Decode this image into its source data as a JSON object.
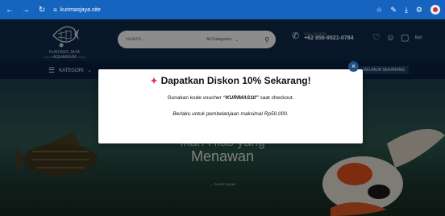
{
  "browser": {
    "url": "kurimasjaya.site",
    "colors": {
      "toolbar": "#1565c0"
    }
  },
  "header": {
    "brand": "KURIMAS JAYA AQUARIUM",
    "tagline": "IKAN HIAS & AKSESORIS AQUARIUM",
    "search_placeholder": "Search...",
    "category_select": "All Categories",
    "call_label": "CALL US NOW:",
    "phone": "+62 858-9521-0784",
    "cart_total": "Rp0"
  },
  "navbar": {
    "kategori_label": "KATEGORI",
    "belanja_label": "BELANJA SEKARANG"
  },
  "hero": {
    "title_line1": "Ikan Hias yang",
    "title_line2": "Menawan",
    "cta": "SHOP NOW"
  },
  "modal": {
    "title": "Dapatkan Diskon 10% Sekarang!",
    "line1_prefix": "Gunakan kode voucher",
    "voucher_code": "“KURIMAS10”",
    "line1_suffix": "saat checkout.",
    "line2": "Berlaku untuk pembelanjaan maksimal Rp50.000.",
    "close_icon": "close-icon",
    "party_icon": "party-popper-icon"
  }
}
